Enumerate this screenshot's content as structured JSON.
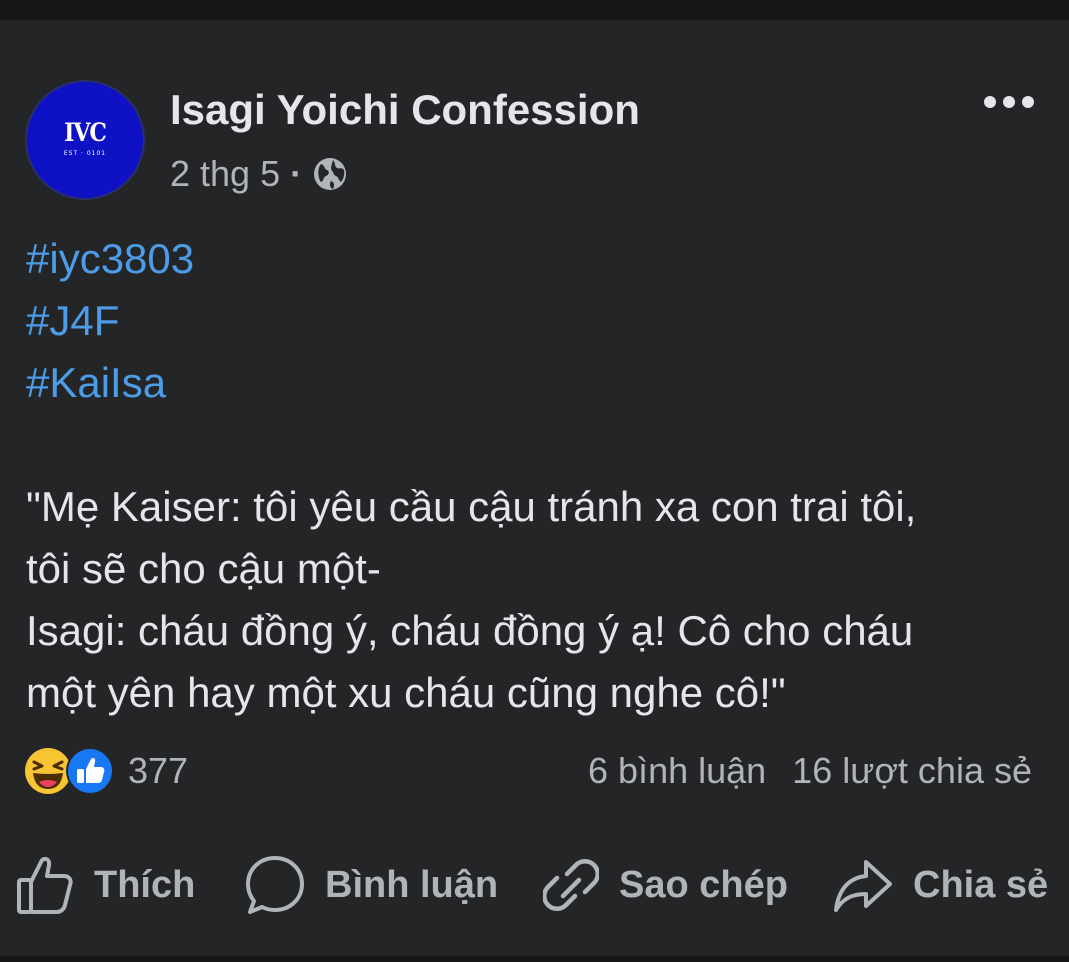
{
  "post": {
    "page_name": "Isagi Yoichi Confession",
    "avatar": {
      "logo_text": "IVC",
      "sub_text": "EST · 0101",
      "bg_color": "#0f12c4"
    },
    "timestamp": "2 thg 5",
    "separator": "·",
    "audience_icon": "globe-icon",
    "hashtags": [
      "#iyc3803",
      "#J4F",
      "#KaiIsa"
    ],
    "body_lines": [
      "\"Mẹ Kaiser: tôi yêu cầu cậu tránh xa con trai tôi,",
      "tôi sẽ cho cậu một-",
      "Isagi: cháu đồng ý, cháu đồng ý ạ! Cô cho cháu",
      "một yên hay một xu cháu cũng nghe cô!\""
    ],
    "reactions": {
      "icons": [
        "haha-emoji-icon",
        "like-reaction-icon"
      ],
      "count": "377"
    },
    "comments": "6 bình luận",
    "shares": "16 lượt chia sẻ"
  },
  "actions": {
    "like": {
      "label": "Thích",
      "icon": "thumbs-up-icon"
    },
    "comment": {
      "label": "Bình luận",
      "icon": "speech-bubble-icon"
    },
    "copy": {
      "label": "Sao chép",
      "icon": "link-icon"
    },
    "share": {
      "label": "Chia sẻ",
      "icon": "share-arrow-icon"
    }
  },
  "colors": {
    "background": "#242526",
    "text_primary": "#e4e6eb",
    "text_secondary": "#b0b3b8",
    "hashtag": "#4d9ce8",
    "like_blue": "#1877f2",
    "haha_yellow": "#f7c433"
  }
}
